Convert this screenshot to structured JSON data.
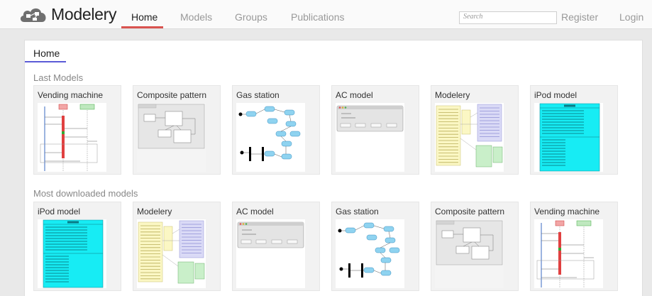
{
  "header": {
    "logo_text": "Modelery",
    "tabs": [
      {
        "label": "Home",
        "active": true
      },
      {
        "label": "Models"
      },
      {
        "label": "Groups"
      },
      {
        "label": "Publications"
      }
    ],
    "search": {
      "placeholder": "Search"
    },
    "register_label": "Register",
    "login_label": "Login",
    "accent_color": "#d9534f"
  },
  "page": {
    "tab_label": "Home",
    "tab_accent_color": "#5b5bd6"
  },
  "sections": [
    {
      "title": "Last Models",
      "models": [
        {
          "title": "Vending machine",
          "thumb": "sequence-diagram"
        },
        {
          "title": "Composite pattern",
          "thumb": "class-diagram"
        },
        {
          "title": "Gas station",
          "thumb": "activity-diagram"
        },
        {
          "title": "AC model",
          "thumb": "ui-window"
        },
        {
          "title": "Modelery",
          "thumb": "colored-class-diagram"
        },
        {
          "title": "iPod model",
          "thumb": "cyan-class"
        }
      ]
    },
    {
      "title": "Most downloaded models",
      "models": [
        {
          "title": "iPod model",
          "thumb": "cyan-class"
        },
        {
          "title": "Modelery",
          "thumb": "colored-class-diagram"
        },
        {
          "title": "AC model",
          "thumb": "ui-window"
        },
        {
          "title": "Gas station",
          "thumb": "activity-diagram"
        },
        {
          "title": "Composite pattern",
          "thumb": "class-diagram"
        },
        {
          "title": "Vending machine",
          "thumb": "sequence-diagram"
        }
      ]
    }
  ]
}
